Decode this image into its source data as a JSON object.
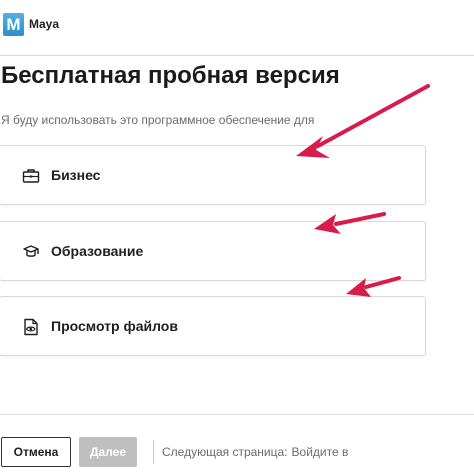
{
  "header": {
    "logo_letter": "M",
    "app_name": "Maya"
  },
  "main": {
    "title": "Бесплатная пробная версия",
    "subtitle": "Я буду использовать это программное обеспечение для",
    "options": [
      {
        "label": "Бизнес",
        "icon": "briefcase-icon"
      },
      {
        "label": "Образование",
        "icon": "graduation-cap-icon"
      },
      {
        "label": "Просмотр файлов",
        "icon": "file-view-icon"
      }
    ]
  },
  "footer": {
    "cancel_label": "Отмена",
    "next_label": "Далее",
    "next_page_label": "Следующая страница:",
    "next_page_value": "Войдите в"
  },
  "annotations": {
    "arrow_color": "#d81b4a",
    "arrow_count": 3
  },
  "colors": {
    "logo_blue": "#2f8fc7",
    "disabled_button": "#bfbfbf"
  }
}
